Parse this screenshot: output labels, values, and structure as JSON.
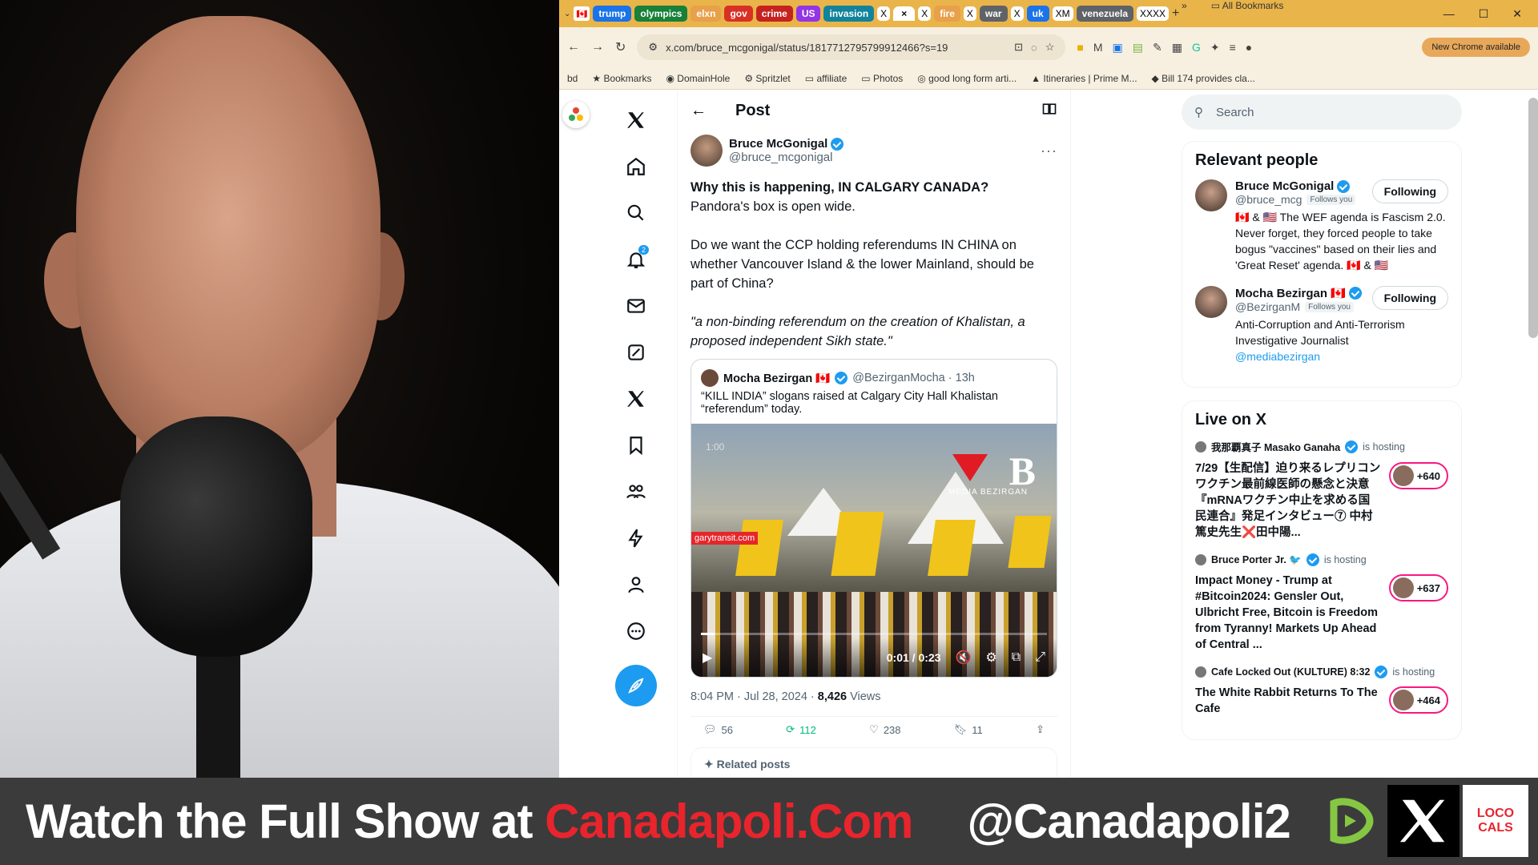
{
  "browser": {
    "tabs": [
      {
        "label": "trump",
        "color": "#1a73e8"
      },
      {
        "label": "olympics",
        "color": "#188038"
      },
      {
        "label": "elxn",
        "color": "#e8a04a"
      },
      {
        "label": "gov",
        "color": "#d93025"
      },
      {
        "label": "crime",
        "color": "#c5221f"
      },
      {
        "label": "US",
        "color": "#9334e6"
      },
      {
        "label": "invasion",
        "color": "#12839c"
      },
      {
        "label": "fire",
        "color": "#e8a04a"
      },
      {
        "label": "war",
        "color": "#5f6368"
      },
      {
        "label": "uk",
        "color": "#1a73e8"
      },
      {
        "label": "venezuela",
        "color": "#5f6368"
      }
    ],
    "url": "x.com/bruce_mcgonigal/status/1817712795799912466?s=19",
    "new_chrome": "New Chrome available",
    "bookmarks": [
      "bd",
      "Bookmarks",
      "DomainHole",
      "Spritzlet",
      "affiliate",
      "Photos",
      "good long form arti...",
      "Itineraries | Prime M...",
      "Bill 174 provides cla..."
    ],
    "all_bookmarks": "All Bookmarks"
  },
  "x": {
    "header_title": "Post",
    "notif_count": "2",
    "author": {
      "name": "Bruce McGonigal",
      "handle": "@bruce_mcgonigal"
    },
    "text": {
      "line1": "Why this is happening, IN CALGARY CANADA?",
      "line2": "Pandora's box is open wide.",
      "para2": "Do we want the CCP holding referendums IN CHINA on whether Vancouver Island & the lower Mainland, should be part of China?",
      "para3": "\"a non-binding referendum on the creation of Khalistan, a proposed independent Sikh state.\""
    },
    "quote": {
      "name": "Mocha Bezirgan 🇨🇦",
      "meta": "@BezirganMocha · 13h",
      "text": "“KILL INDIA” slogans raised at Calgary City Hall Khalistan “referendum” today.",
      "video_time": "0:01 / 0:23",
      "video_stamp": "1:00",
      "watermark": "MEDIA BEZIRGAN",
      "site": "garytransit.com",
      "progress": 0.04
    },
    "timestamp": "8:04 PM · Jul 28, 2024 ·",
    "views": "8,426",
    "views_label": "Views",
    "counts": {
      "replies": "56",
      "reposts": "112",
      "likes": "238",
      "bookmarks": "11"
    },
    "related": "Related posts"
  },
  "sidebar": {
    "search_placeholder": "Search",
    "relevant_title": "Relevant people",
    "people": [
      {
        "name": "Bruce McGonigal",
        "handle": "@bruce_mcg",
        "follows": "Follows you",
        "button": "Following",
        "bio": "🇨🇦 & 🇺🇸 The WEF agenda is Fascism 2.0. Never forget, they forced people to take bogus \"vaccines\" based on their lies and 'Great Reset' agenda. 🇨🇦 & 🇺🇸"
      },
      {
        "name": "Mocha Bezirgan 🇨🇦",
        "handle": "@BezirganM",
        "follows": "Follows you",
        "button": "Following",
        "bio": "Anti-Corruption and Anti-Terrorism Investigative Journalist",
        "link": "@mediabezirgan"
      }
    ],
    "live_title": "Live on X",
    "live": [
      {
        "host": "我那覇真子 Masako Ganaha",
        "hosting": "is hosting",
        "title": "7/29【生配信】迫り来るレプリコンワクチン最前線医師の懸念と決意『mRNAワクチン中止を求める国民連合』発足インタビュー⑦ 中村篤史先生❌田中陽...",
        "count": "+640"
      },
      {
        "host": "Bruce Porter Jr. 🐦",
        "hosting": "is hosting",
        "title": "Impact Money - Trump at #Bitcoin2024: Gensler Out, Ulbricht Free, Bitcoin is Freedom from Tyranny! Markets Up Ahead of Central ...",
        "count": "+637"
      },
      {
        "host": "Cafe Locked Out (KULTURE) 8:32",
        "hosting": "is hosting",
        "title": "The White Rabbit Returns To The Cafe",
        "count": "+464"
      }
    ]
  },
  "banner": {
    "prefix": "Watch the Full Show at ",
    "site": "Canadapoli.Com",
    "handle": "@Canadapoli2",
    "logo_text": "LOCO CALS"
  }
}
